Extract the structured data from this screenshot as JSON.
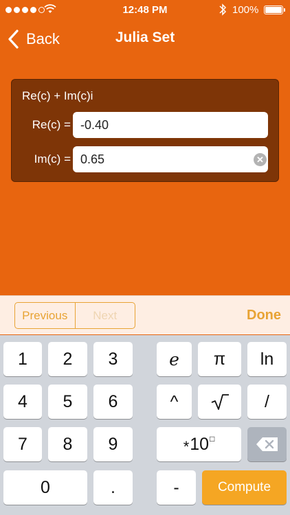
{
  "status_bar": {
    "time": "12:48 PM",
    "battery": "100%",
    "signal_bars_filled": 4,
    "signal_bars_total": 5,
    "icons": [
      "signal-dots",
      "wifi-icon",
      "bluetooth-icon",
      "battery-icon"
    ]
  },
  "nav": {
    "back_label": "Back",
    "title": "Julia Set"
  },
  "formula": {
    "title": "Re(c) + Im(c)i",
    "re_label": "Re(c) =",
    "re_value": "-0.40",
    "im_label": "Im(c) =",
    "im_value": "0.65"
  },
  "accessory": {
    "previous_label": "Previous",
    "next_label": "Next",
    "done_label": "Done"
  },
  "keyboard": {
    "keys": {
      "k1": "1",
      "k2": "2",
      "k3": "3",
      "k4": "4",
      "k5": "5",
      "k6": "6",
      "k7": "7",
      "k8": "8",
      "k9": "9",
      "k0": "0",
      "dot": ".",
      "minus": "-",
      "e": "e",
      "pi": "π",
      "ln": "ln",
      "power": "^",
      "divide": "/",
      "exp_star": "*",
      "exp_ten": "10",
      "exp_box": "□",
      "compute": "Compute"
    }
  },
  "colors": {
    "background": "#E8650F",
    "panel": "#7E3507",
    "accent": "#E8A334",
    "compute_key": "#F5A623"
  }
}
